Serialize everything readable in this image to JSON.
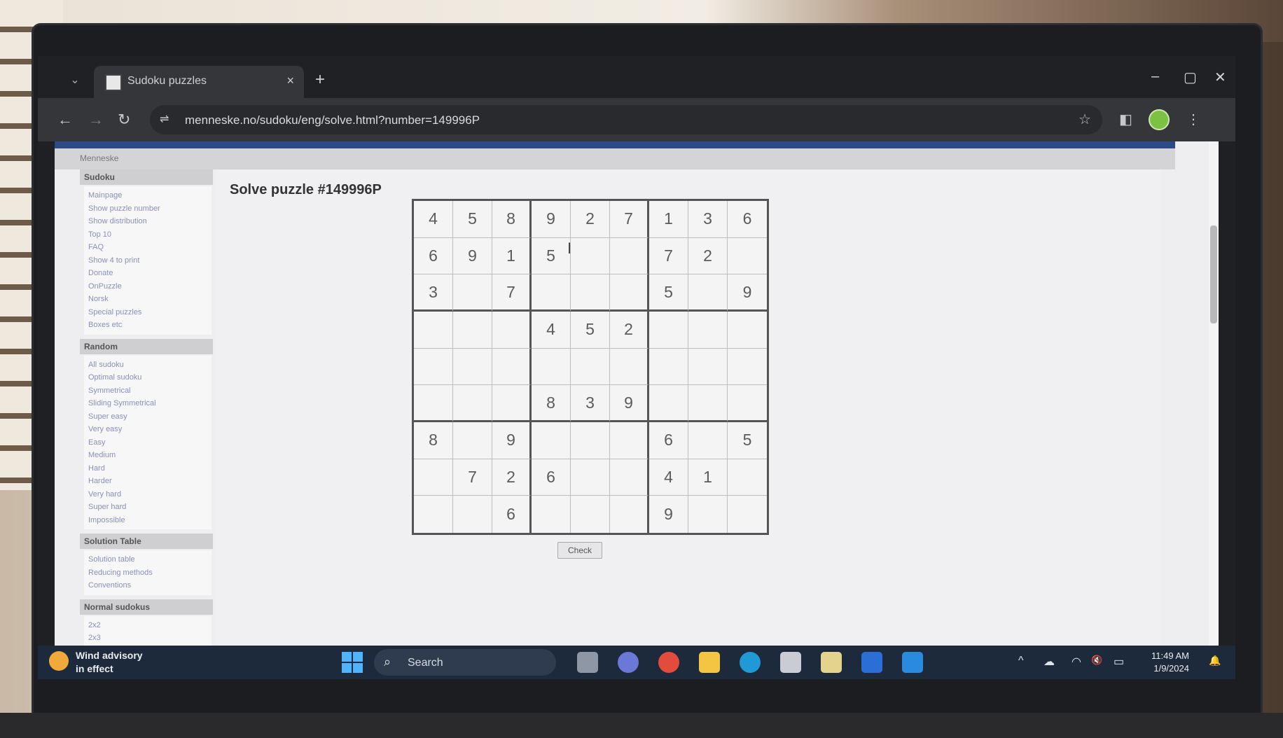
{
  "browser": {
    "tab_title": "Sudoku puzzles",
    "tab_close": "×",
    "new_tab": "+",
    "url": "menneske.no/sudoku/eng/solve.html?number=149996P",
    "window_controls": {
      "minimize": "–",
      "maximize": "▢",
      "close": "✕"
    },
    "nav": {
      "back": "←",
      "forward": "→",
      "reload": "↻"
    },
    "icons": {
      "bookmark": "☆",
      "side_panel": "◧",
      "menu": "⋮",
      "tune": "⇌",
      "tab_search": "⌄"
    }
  },
  "site": {
    "header": "Menneske",
    "sidebar": [
      {
        "title": "Sudoku",
        "items": [
          "Mainpage",
          "Show puzzle number",
          "Show distribution",
          "Top 10",
          "FAQ",
          "Show 4 to print",
          "Donate",
          "OnPuzzle",
          "Norsk",
          "Special puzzles",
          "Boxes etc"
        ]
      },
      {
        "title": "Random",
        "items": [
          "All sudoku",
          "Optimal sudoku",
          "Symmetrical",
          "Sliding Symmetrical",
          "Super easy",
          "Very easy",
          "Easy",
          "Medium",
          "Hard",
          "Harder",
          "Very hard",
          "Super hard",
          "Impossible"
        ]
      },
      {
        "title": "Solution Table",
        "items": [
          "Solution table",
          "Reducing methods",
          "Conventions"
        ]
      },
      {
        "title": "Normal sudokus",
        "items": [
          "2x2",
          "2x3"
        ]
      }
    ]
  },
  "puzzle": {
    "title": "Solve puzzle #149996P",
    "grid": [
      [
        "4",
        "5",
        "8",
        "9",
        "2",
        "7",
        "1",
        "3",
        "6"
      ],
      [
        "6",
        "9",
        "1",
        "5",
        "",
        "",
        "7",
        "2",
        ""
      ],
      [
        "3",
        "",
        "7",
        "",
        "",
        "",
        "5",
        "",
        "9"
      ],
      [
        "",
        "",
        "",
        "4",
        "5",
        "2",
        "",
        "",
        ""
      ],
      [
        "",
        "",
        "",
        "",
        "",
        "",
        "",
        "",
        ""
      ],
      [
        "",
        "",
        "",
        "8",
        "3",
        "9",
        "",
        "",
        ""
      ],
      [
        "8",
        "",
        "9",
        "",
        "",
        "",
        "6",
        "",
        "5"
      ],
      [
        "",
        "7",
        "2",
        "6",
        "",
        "",
        "4",
        "1",
        ""
      ],
      [
        "",
        "",
        "6",
        "",
        "",
        "",
        "9",
        "",
        ""
      ]
    ],
    "check_label": "Check",
    "text_cursor": "I"
  },
  "taskbar": {
    "weather_line1": "Wind advisory",
    "weather_line2": "in effect",
    "search_placeholder": "Search",
    "search_icon": "⌕",
    "tray": {
      "chevron": "^",
      "cloud": "☁",
      "wifi": "◠",
      "volume": "🔇",
      "battery": "▭",
      "bell": "🔔"
    },
    "time": "11:49 AM",
    "date": "1/9/2024",
    "colors": {
      "start": "#4fb3ff",
      "files": "#f4c542",
      "edge": "#1f9ad6",
      "word": "#2b6fd6",
      "vscode": "#2a8bde",
      "chrome": "#e24c3c"
    }
  }
}
